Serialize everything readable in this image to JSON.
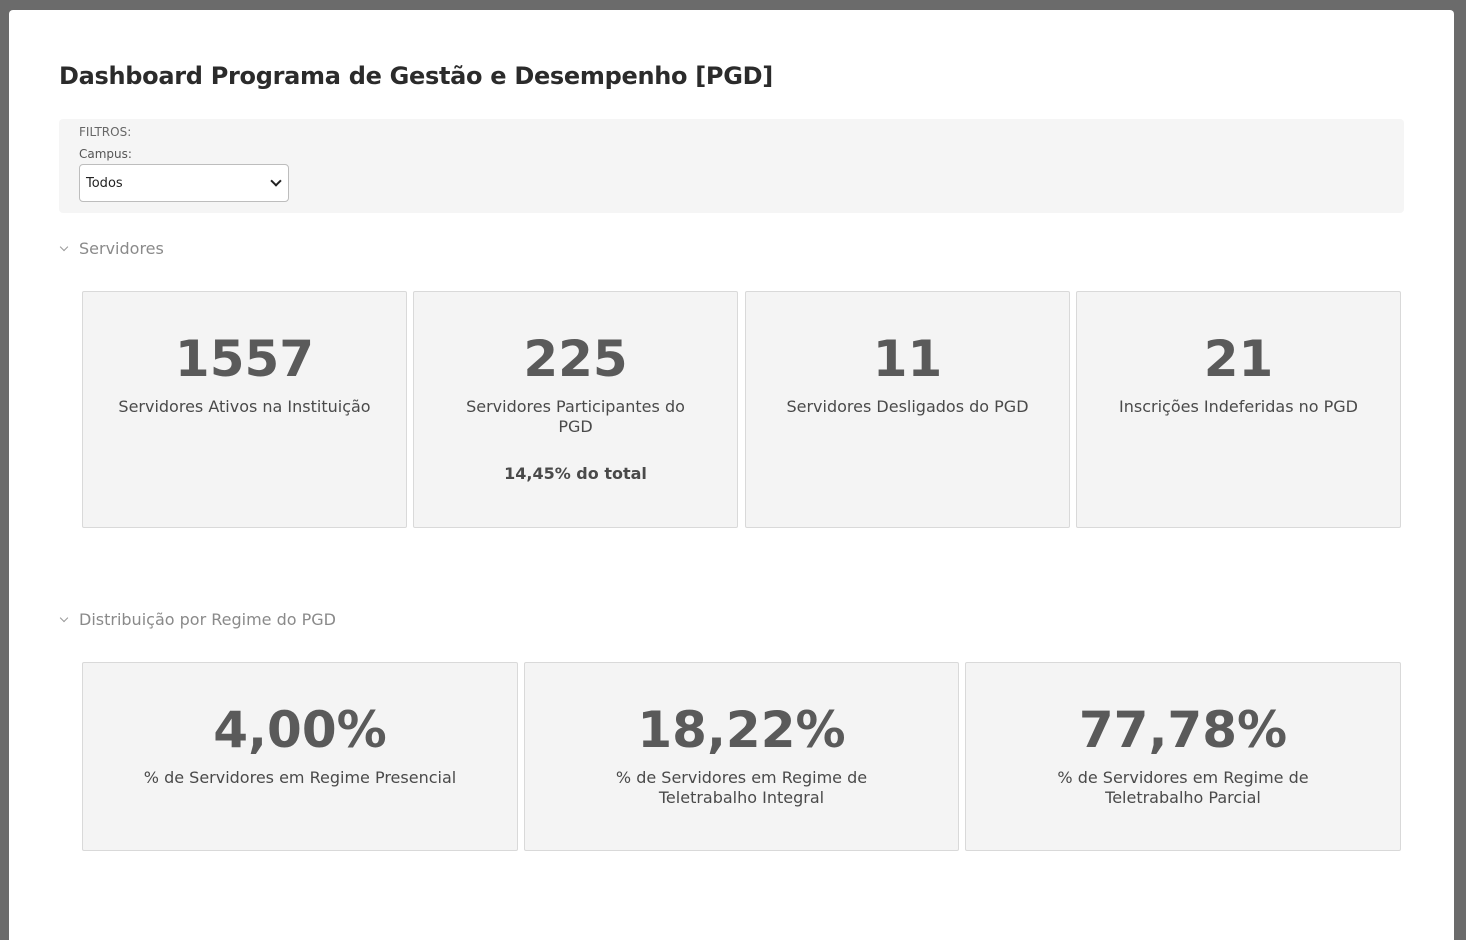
{
  "page": {
    "title": "Dashboard Programa de Gestão e Desempenho [PGD]"
  },
  "filters": {
    "heading": "FILTROS:",
    "campus_label": "Campus:",
    "campus_selected": "Todos"
  },
  "sections": {
    "servidores": {
      "title": "Servidores",
      "cards": [
        {
          "value": "1557",
          "label": "Servidores Ativos na Instituição"
        },
        {
          "value": "225",
          "label": "Servidores Participantes do PGD",
          "sub": "14,45% do total"
        },
        {
          "value": "11",
          "label": "Servidores Desligados do PGD"
        },
        {
          "value": "21",
          "label": "Inscrições Indeferidas no PGD"
        }
      ]
    },
    "regime": {
      "title": "Distribuição por Regime do PGD",
      "cards": [
        {
          "value": "4,00%",
          "label": "% de Servidores em Regime Presencial"
        },
        {
          "value": "18,22%",
          "label": "% de Servidores em Regime de Teletrabalho Integral"
        },
        {
          "value": "77,78%",
          "label": "% de Servidores em Regime de Teletrabalho Parcial"
        }
      ]
    }
  }
}
